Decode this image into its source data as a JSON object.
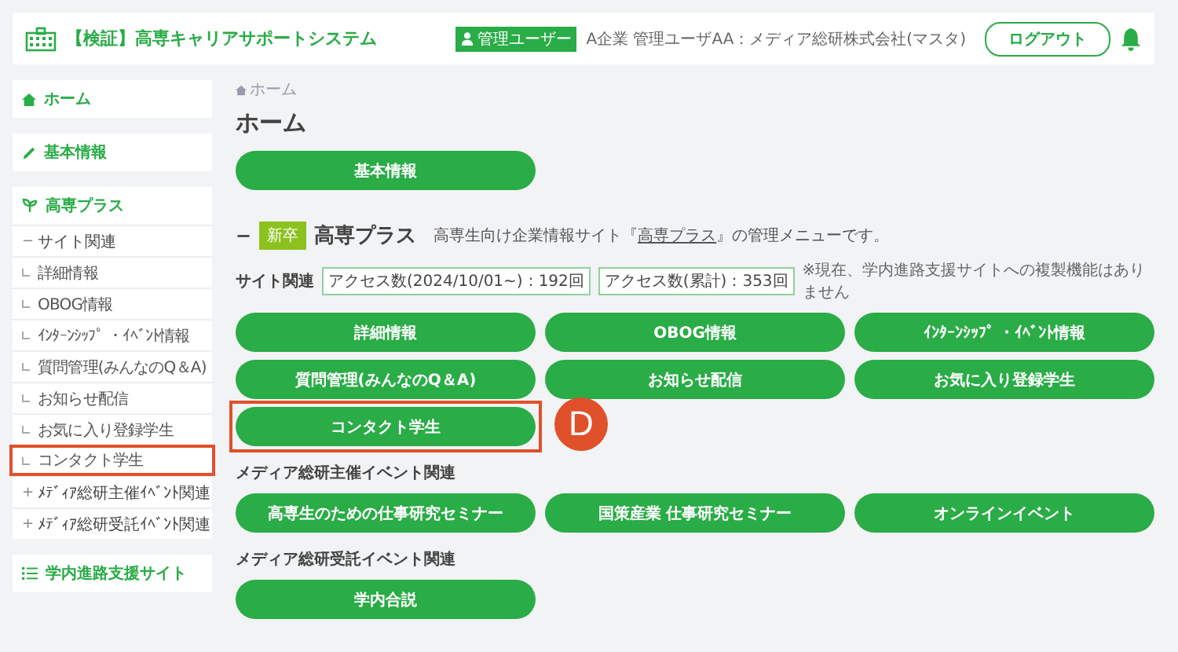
{
  "header": {
    "title": "【検証】高専キャリアサポートシステム",
    "role_badge": "管理ユーザー",
    "user": "A企業 管理ユーザAA：メディア総研株式会社(マスタ)",
    "logout": "ログアウト"
  },
  "sidebar": {
    "sections": [
      {
        "label": "ホーム"
      },
      {
        "label": "基本情報"
      },
      {
        "label": "高専プラス",
        "items": [
          {
            "toggle": "−",
            "label": "サイト関連",
            "highlighted": false,
            "children": [
              {
                "label": "詳細情報",
                "highlighted": false
              },
              {
                "label": "OBOG情報",
                "highlighted": false
              },
              {
                "label": "ｲﾝﾀｰﾝｼｯﾌﾟ ・ｲﾍﾞﾝﾄ情報",
                "highlighted": false
              },
              {
                "label": "質問管理(みんなのQ＆A)",
                "highlighted": false
              },
              {
                "label": "お知らせ配信",
                "highlighted": false
              },
              {
                "label": "お気に入り登録学生",
                "highlighted": false
              },
              {
                "label": "コンタクト学生",
                "highlighted": true
              }
            ]
          },
          {
            "toggle": "+",
            "label": "ﾒﾃﾞｨｱ総研主催ｲﾍﾞﾝﾄ関連",
            "highlighted": false
          },
          {
            "toggle": "+",
            "label": "ﾒﾃﾞｨｱ総研受託ｲﾍﾞﾝﾄ関連",
            "highlighted": false
          }
        ]
      },
      {
        "label": "学内進路支援サイト"
      }
    ]
  },
  "main": {
    "breadcrumb": "ホーム",
    "title": "ホーム",
    "top_buttons": [
      {
        "label": "基本情報",
        "highlighted": false
      }
    ],
    "section": {
      "toggle": "−",
      "badge": "新卒",
      "title": "高専プラス",
      "description_before": "高専生向け企業情報サイト『",
      "description_link": "高専プラス",
      "description_after": "』の管理メニューです。"
    },
    "groups": [
      {
        "label": "サイト関連",
        "stats": [
          "アクセス数(2024/10/01~)：192回",
          "アクセス数(累計)：353回"
        ],
        "note": "※現在、学内進路支援サイトへの複製機能はありません",
        "buttons": [
          {
            "label": "詳細情報",
            "highlighted": false
          },
          {
            "label": "OBOG情報",
            "highlighted": false
          },
          {
            "label": "ｲﾝﾀｰﾝｼｯﾌﾟ ・ｲﾍﾞﾝﾄ情報",
            "highlighted": false
          },
          {
            "label": "質問管理(みんなのQ＆A)",
            "highlighted": false
          },
          {
            "label": "お知らせ配信",
            "highlighted": false
          },
          {
            "label": "お気に入り登録学生",
            "highlighted": false
          },
          {
            "label": "コンタクト学生",
            "highlighted": true,
            "callout": "D"
          }
        ]
      },
      {
        "label": "メディア総研主催イベント関連",
        "buttons": [
          {
            "label": "高専生のための仕事研究セミナー",
            "highlighted": false
          },
          {
            "label": "国策産業 仕事研究セミナー",
            "highlighted": false
          },
          {
            "label": "オンラインイベント",
            "highlighted": false
          }
        ]
      },
      {
        "label": "メディア総研受託イベント関連",
        "buttons": [
          {
            "label": "学内合説",
            "highlighted": false
          }
        ]
      }
    ]
  }
}
